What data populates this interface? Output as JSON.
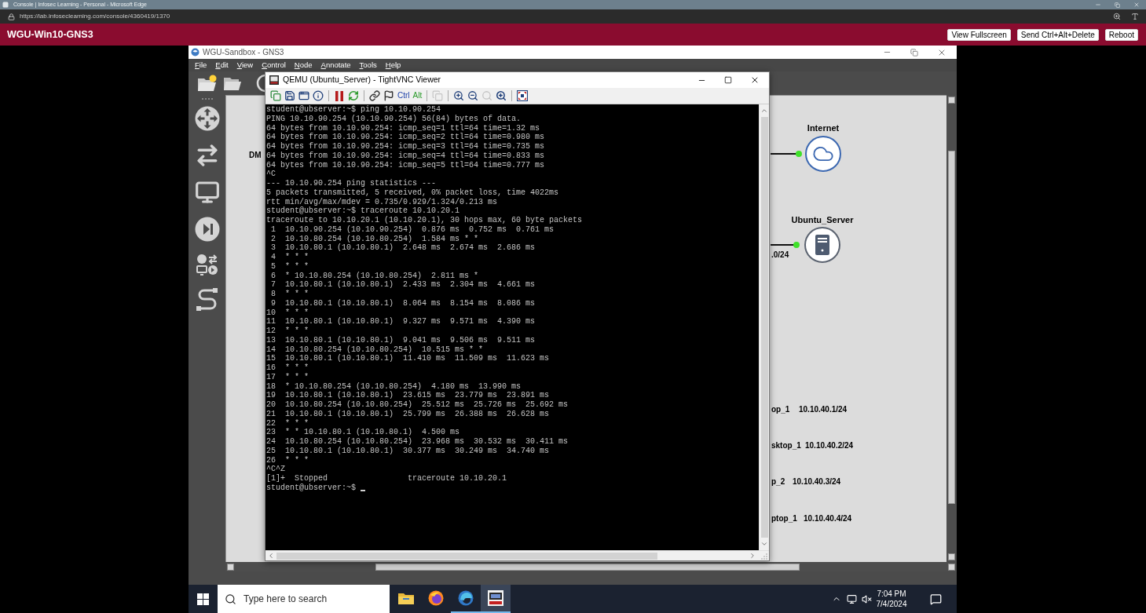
{
  "browser": {
    "title": "Console | Infosec Learning - Personal - Microsoft Edge",
    "url": "https://lab.infoseclearning.com/console/4360419/1370"
  },
  "console_bar": {
    "title": "WGU-Win10-GNS3",
    "buttons": [
      "View Fullscreen",
      "Send Ctrl+Alt+Delete",
      "Reboot"
    ]
  },
  "gns3": {
    "title": "WGU-Sandbox - GNS3",
    "menu": [
      "File",
      "Edit",
      "View",
      "Control",
      "Node",
      "Annotate",
      "Tools",
      "Help"
    ],
    "canvas": {
      "nodes": [
        {
          "kind": "cloud",
          "label": "Internet"
        },
        {
          "kind": "server",
          "label": "Ubuntu_Server"
        }
      ],
      "labels": [
        {
          "text": "DM"
        },
        {
          "text": ".0/24"
        },
        {
          "text": "op_1"
        },
        {
          "text": "10.10.40.1/24"
        },
        {
          "text": "sktop_1"
        },
        {
          "text": "10.10.40.2/24"
        },
        {
          "text": "p_2"
        },
        {
          "text": "10.10.40.3/24"
        },
        {
          "text": "ptop_1"
        },
        {
          "text": "10.10.40.4/24"
        }
      ]
    }
  },
  "vnc": {
    "title": "QEMU (Ubuntu_Server) - TightVNC Viewer",
    "toolbar_groups": [
      {
        "buttons": [
          {
            "kind": "connect",
            "disabled": false
          },
          {
            "kind": "save",
            "disabled": false
          },
          {
            "kind": "options",
            "disabled": false
          },
          {
            "kind": "info",
            "disabled": false
          }
        ]
      },
      {
        "buttons": [
          {
            "kind": "pause",
            "disabled": false
          },
          {
            "kind": "refresh",
            "disabled": false
          }
        ]
      },
      {
        "buttons": [
          {
            "kind": "ctrl-alt-del",
            "disabled": false
          },
          {
            "kind": "win-key",
            "disabled": false
          },
          {
            "kind": "ctrl",
            "label": "Ctrl",
            "disabled": false
          },
          {
            "kind": "alt",
            "label": "Alt",
            "disabled": false
          }
        ]
      },
      {
        "buttons": [
          {
            "kind": "clipboard",
            "disabled": true
          }
        ]
      },
      {
        "buttons": [
          {
            "kind": "zoom-in",
            "disabled": false
          },
          {
            "kind": "zoom-out",
            "disabled": false
          },
          {
            "kind": "zoom-reset",
            "disabled": true
          },
          {
            "kind": "zoom-fit",
            "disabled": false
          }
        ]
      },
      {
        "buttons": [
          {
            "kind": "fullscreen",
            "disabled": false
          }
        ]
      }
    ],
    "terminal": {
      "cursor": true,
      "lines": [
        "student@ubserver:~$ ping 10.10.90.254",
        "PING 10.10.90.254 (10.10.90.254) 56(84) bytes of data.",
        "64 bytes from 10.10.90.254: icmp_seq=1 ttl=64 time=1.32 ms",
        "64 bytes from 10.10.90.254: icmp_seq=2 ttl=64 time=0.980 ms",
        "64 bytes from 10.10.90.254: icmp_seq=3 ttl=64 time=0.735 ms",
        "64 bytes from 10.10.90.254: icmp_seq=4 ttl=64 time=0.833 ms",
        "64 bytes from 10.10.90.254: icmp_seq=5 ttl=64 time=0.777 ms",
        "^C",
        "--- 10.10.90.254 ping statistics ---",
        "5 packets transmitted, 5 received, 0% packet loss, time 4022ms",
        "rtt min/avg/max/mdev = 0.735/0.929/1.324/0.213 ms",
        "student@ubserver:~$ traceroute 10.10.20.1",
        "traceroute to 10.10.20.1 (10.10.20.1), 30 hops max, 60 byte packets",
        " 1  10.10.90.254 (10.10.90.254)  0.876 ms  0.752 ms  0.761 ms",
        " 2  10.10.80.254 (10.10.80.254)  1.584 ms * *",
        " 3  10.10.80.1 (10.10.80.1)  2.648 ms  2.674 ms  2.686 ms",
        " 4  * * *",
        " 5  * * *",
        " 6  * 10.10.80.254 (10.10.80.254)  2.811 ms *",
        " 7  10.10.80.1 (10.10.80.1)  2.433 ms  2.304 ms  4.661 ms",
        " 8  * * *",
        " 9  10.10.80.1 (10.10.80.1)  8.064 ms  8.154 ms  8.086 ms",
        "10  * * *",
        "11  10.10.80.1 (10.10.80.1)  9.327 ms  9.571 ms  4.390 ms",
        "12  * * *",
        "13  10.10.80.1 (10.10.80.1)  9.041 ms  9.506 ms  9.511 ms",
        "14  10.10.80.254 (10.10.80.254)  10.515 ms * *",
        "15  10.10.80.1 (10.10.80.1)  11.410 ms  11.509 ms  11.623 ms",
        "16  * * *",
        "17  * * *",
        "18  * 10.10.80.254 (10.10.80.254)  4.180 ms  13.990 ms",
        "19  10.10.80.1 (10.10.80.1)  23.615 ms  23.779 ms  23.891 ms",
        "20  10.10.80.254 (10.10.80.254)  25.512 ms  25.726 ms  25.692 ms",
        "21  10.10.80.1 (10.10.80.1)  25.799 ms  26.388 ms  26.628 ms",
        "22  * * *",
        "23  * * 10.10.80.1 (10.10.80.1)  4.500 ms",
        "24  10.10.80.254 (10.10.80.254)  23.968 ms  30.532 ms  30.411 ms",
        "25  10.10.80.1 (10.10.80.1)  30.377 ms  30.249 ms  34.740 ms",
        "26  * * *",
        "^C^Z",
        "[1]+  Stopped                 traceroute 10.10.20.1",
        "student@ubserver:~$"
      ]
    }
  },
  "taskbar": {
    "search": {
      "placeholder": "Type here to search"
    },
    "apps": [
      {
        "kind": "files",
        "running": false,
        "selected": false
      },
      {
        "kind": "globe",
        "running": false,
        "selected": false
      },
      {
        "kind": "swirl",
        "running": true,
        "selected": false
      },
      {
        "kind": "viewer",
        "running": true,
        "selected": true
      }
    ],
    "clock": {
      "time": "7:04 PM",
      "date": "7/4/2024"
    }
  }
}
